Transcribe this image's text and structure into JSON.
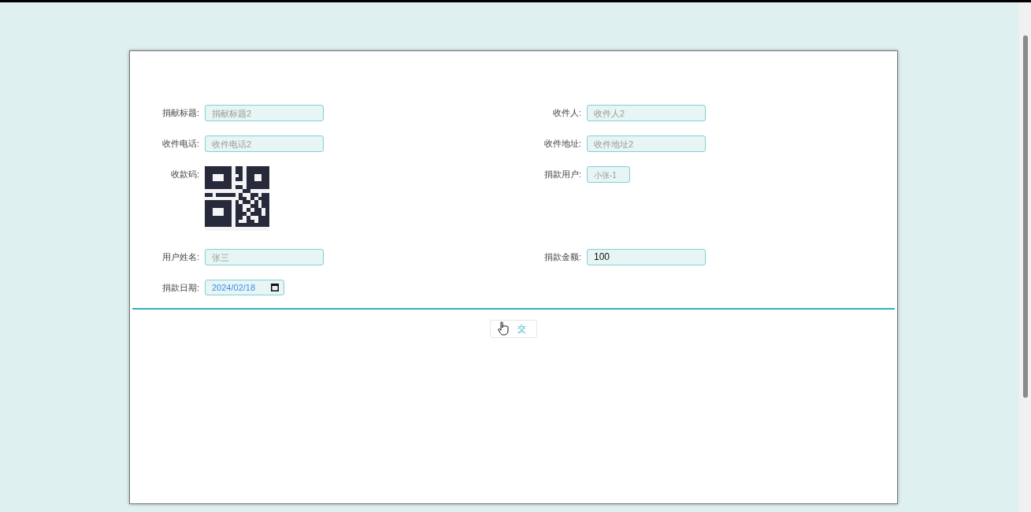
{
  "form": {
    "rows": [
      [
        {
          "label": "捐献标题:",
          "kind": "text",
          "value": "捐献标题2",
          "disabled": true
        },
        {
          "label": "收件人:",
          "kind": "text",
          "value": "收件人2",
          "disabled": true
        }
      ],
      [
        {
          "label": "收件电话:",
          "kind": "text",
          "value": "收件电话2",
          "disabled": true
        },
        {
          "label": "收件地址:",
          "kind": "text",
          "value": "收件地址2",
          "disabled": true
        }
      ],
      [
        {
          "label": "收款码:",
          "kind": "qr"
        },
        {
          "label": "捐款用户:",
          "kind": "short",
          "value": "小张-1",
          "disabled": true
        }
      ],
      [
        {
          "label": "用户姓名:",
          "kind": "text",
          "value": "张三",
          "disabled": true
        },
        {
          "label": "捐款金额:",
          "kind": "text",
          "value": "100",
          "disabled": false
        }
      ],
      [
        {
          "label": "捐款日期:",
          "kind": "date",
          "value": "2024/02/18"
        }
      ]
    ]
  },
  "submit_button": {
    "label": "交"
  }
}
